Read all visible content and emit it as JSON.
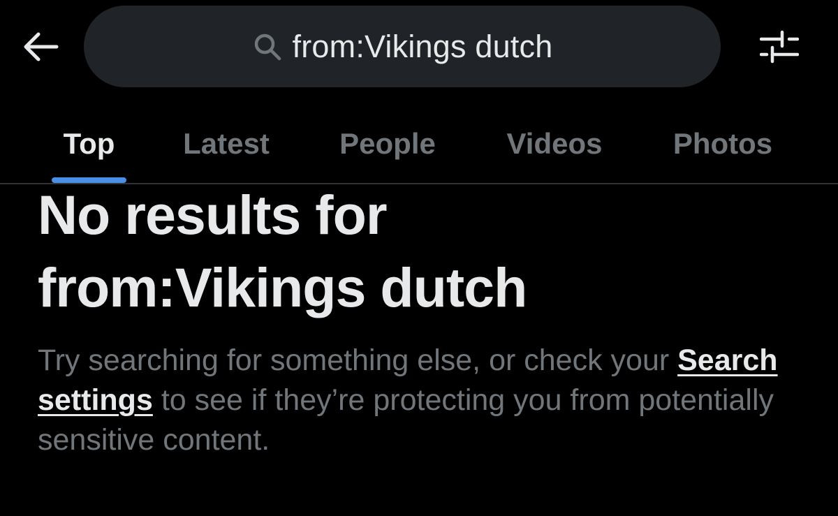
{
  "header": {
    "back_icon": "arrow-left-icon",
    "search": {
      "icon": "search-icon",
      "value": "from:Vikings dutch"
    },
    "filter_icon": "sliders-icon"
  },
  "tabs": [
    {
      "label": "Top",
      "active": true
    },
    {
      "label": "Latest",
      "active": false
    },
    {
      "label": "People",
      "active": false
    },
    {
      "label": "Videos",
      "active": false
    },
    {
      "label": "Photos",
      "active": false
    }
  ],
  "empty_state": {
    "title_line1": "No results for",
    "title_line2": "from:Vikings dutch",
    "body_before": "Try searching for something else, or check your ",
    "link_label": "Search settings",
    "body_after": " to see if they’re protecting you from potentially sensitive content."
  },
  "colors": {
    "background": "#000000",
    "search_pill": "#202327",
    "primary_text": "#e7e9ea",
    "secondary_text": "#71767b",
    "accent": "#4a8fe7",
    "divider": "#2f3336"
  }
}
